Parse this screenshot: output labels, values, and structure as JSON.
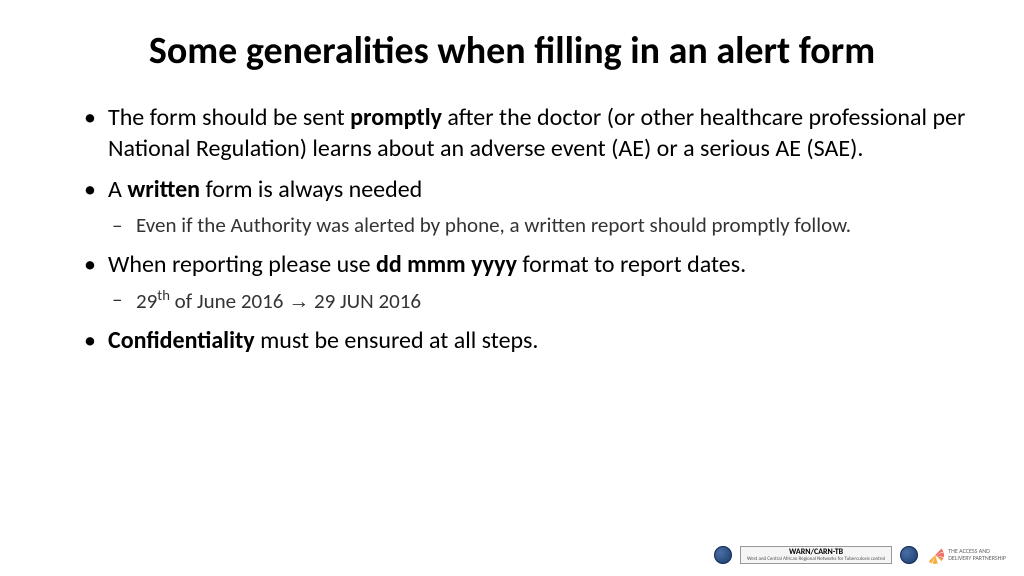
{
  "title": "Some generalities when filling in an alert form",
  "bullets": [
    {
      "pre": "The form should be sent ",
      "bold": "promptly",
      "post": " after the doctor (or other healthcare professional per National Regulation) learns about an adverse event (AE) or a serious AE (SAE)."
    },
    {
      "pre": "A ",
      "bold": "written",
      "post": " form is always needed",
      "sub": [
        "Even if the Authority was alerted by phone, a written report should promptly follow."
      ]
    },
    {
      "pre": "When reporting please use ",
      "bold": "dd mmm yyyy",
      "post": " format to report dates.",
      "sub_date": {
        "day": "29",
        "sup": "th",
        "mid": " of June 2016 ",
        "arrow": "→",
        "result": " 29 JUN 2016"
      }
    },
    {
      "bold": "Confidentiality",
      "post": " must be ensured at all steps."
    }
  ],
  "footer": {
    "warn_title": "WARN/CARN-TB",
    "warn_sub": "West and Central African Regional Networks for Tuberculosis control",
    "adp_line1": "THE ACCESS AND",
    "adp_line2": "DELIVERY PARTNERSHIP"
  }
}
